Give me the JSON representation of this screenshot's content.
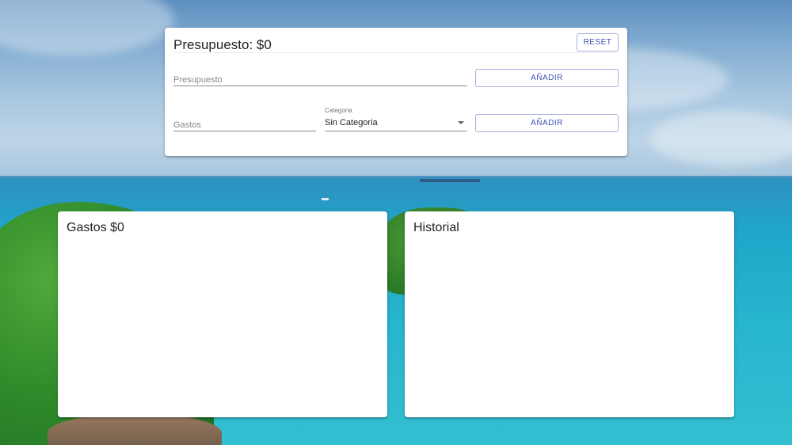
{
  "budget_panel": {
    "title": "Presupuesto: $0",
    "reset_label": "RESET",
    "budget_placeholder": "Presupuesto",
    "add_budget_label": "AÑADIR",
    "expense_placeholder": "Gastos",
    "category_label": "Categoria",
    "category_value": "Sin Categoria",
    "add_expense_label": "AÑADIR"
  },
  "expenses_panel": {
    "title": "Gastos $0"
  },
  "history_panel": {
    "title": "Historial"
  },
  "colors": {
    "accent": "#3f51b5",
    "card": "#ffffff"
  }
}
